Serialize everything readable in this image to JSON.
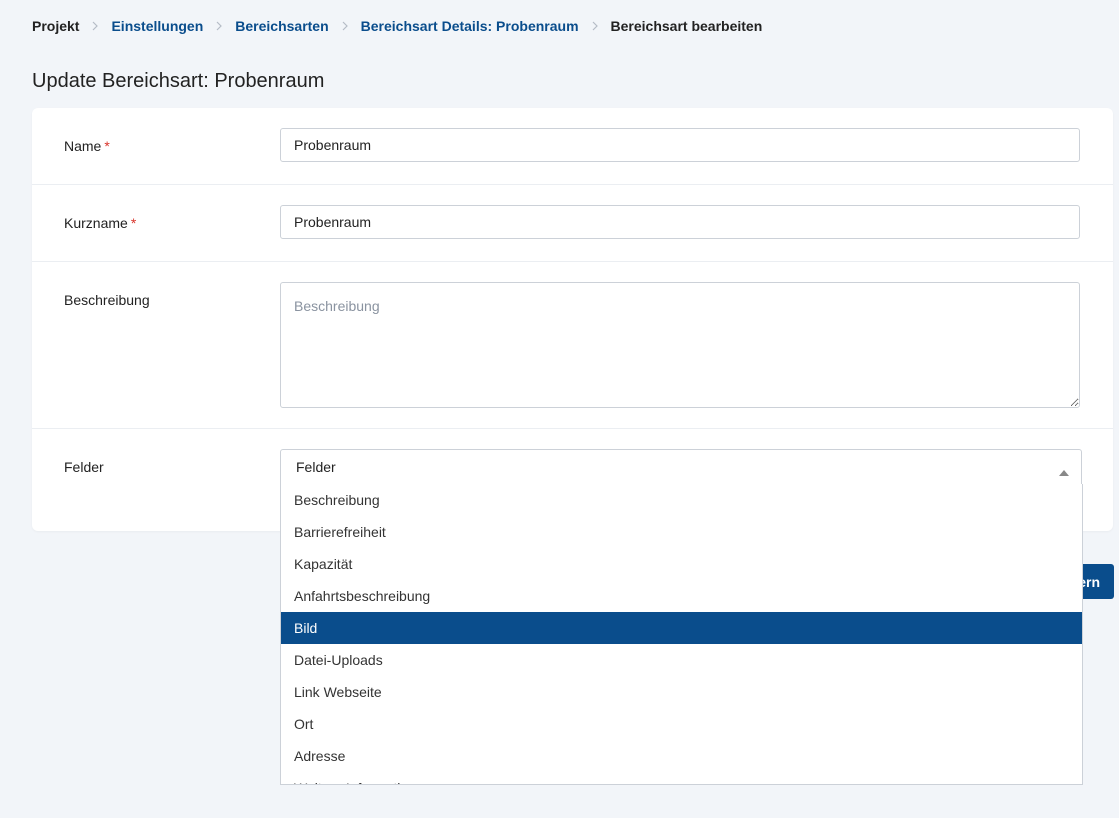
{
  "breadcrumb": [
    {
      "label": "Projekt",
      "link": false
    },
    {
      "label": "Einstellungen",
      "link": true
    },
    {
      "label": "Bereichsarten",
      "link": true
    },
    {
      "label": "Bereichsart Details: Probenraum",
      "link": true
    },
    {
      "label": "Bereichsart bearbeiten",
      "link": false
    }
  ],
  "page": {
    "title": "Update Bereichsart: Probenraum"
  },
  "form": {
    "name": {
      "label": "Name",
      "required_marker": "*",
      "value": "Probenraum"
    },
    "kurzname": {
      "label": "Kurzname",
      "required_marker": "*",
      "value": "Probenraum"
    },
    "beschreibung": {
      "label": "Beschreibung",
      "placeholder": "Beschreibung",
      "value": ""
    },
    "felder": {
      "label": "Felder",
      "placeholder": "Felder",
      "open": true,
      "options": [
        "Beschreibung",
        "Barrierefreiheit",
        "Kapazität",
        "Anfahrtsbeschreibung",
        "Bild",
        "Datei-Uploads",
        "Link Webseite",
        "Ort",
        "Adresse",
        "Weitere Informationen"
      ],
      "highlighted_index": 4
    }
  },
  "actions": {
    "save_label_visible": "ern"
  },
  "colors": {
    "primary": "#0a4d8c",
    "required": "#d9342b",
    "background": "#f2f5f9"
  },
  "icons": {
    "breadcrumb_separator": "chevron-right-icon",
    "select_arrow": "caret-up-icon"
  }
}
